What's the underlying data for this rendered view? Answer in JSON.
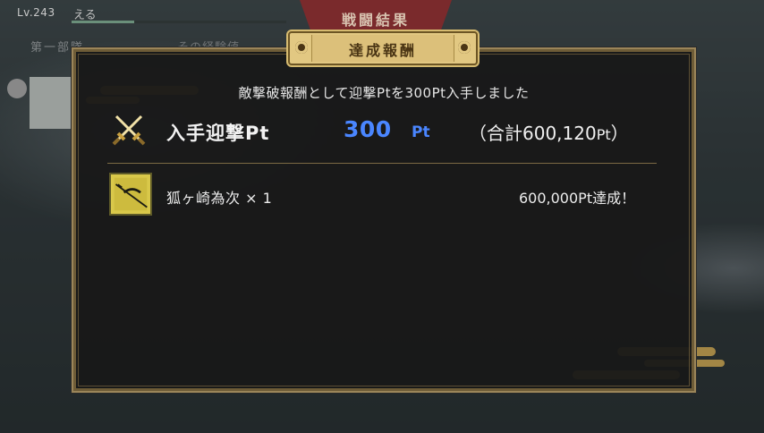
{
  "header": {
    "level": "Lv.243",
    "player_name": "える",
    "exp_progress": 0.29,
    "banner_title": "戦闘結果",
    "section_label": "第一部隊",
    "section_label2": "その経験値"
  },
  "modal": {
    "title": "達成報酬",
    "description": "敵撃破報酬として迎撃Ptを300Pt入手しました",
    "points": {
      "label": "入手迎撃Pt",
      "value": "300",
      "unit": "Pt",
      "total_prefix": "（合計600,120",
      "total_unit": "Pt",
      "total_suffix": "）"
    },
    "reward": {
      "icon": "sword-item-icon",
      "name": "狐ヶ崎為次 × 1",
      "status": "600,000Pt達成！"
    }
  },
  "colors": {
    "accent_blue": "#4a86ff",
    "frame_gold": "#9b8559",
    "tab_gold": "#e2c882",
    "banner_red": "#7a2a2c"
  }
}
